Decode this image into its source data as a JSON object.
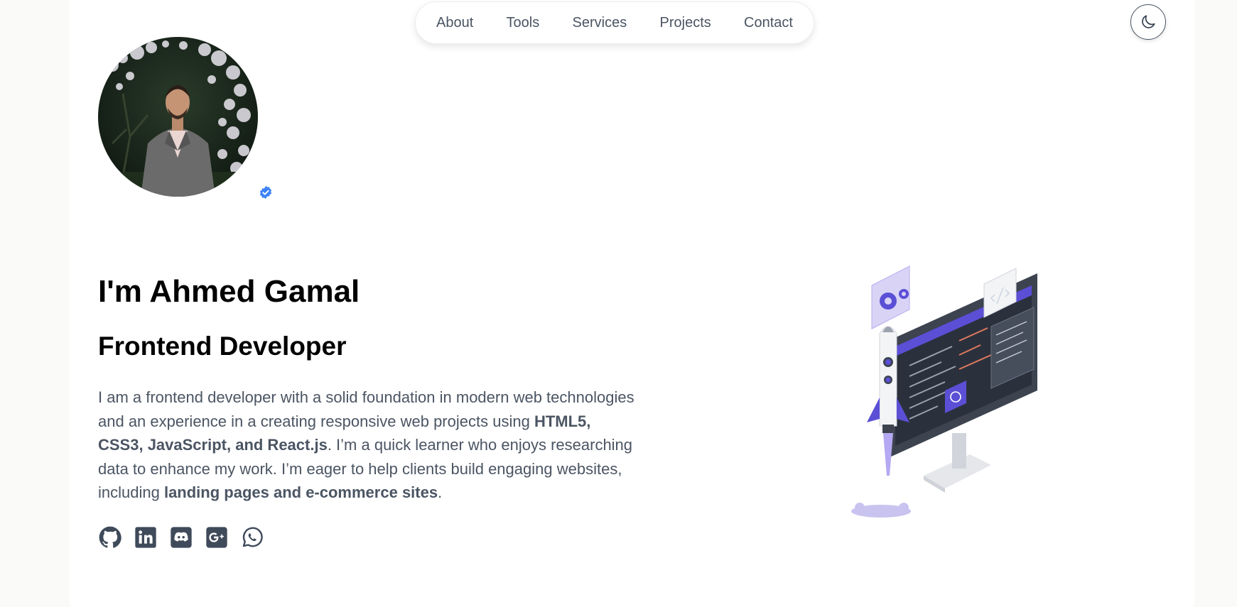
{
  "nav": {
    "items": [
      "About",
      "Tools",
      "Services",
      "Projects",
      "Contact"
    ]
  },
  "theme_toggle": {
    "icon": "moon-icon"
  },
  "profile": {
    "avatar": "profile-photo",
    "verified_icon": "verified-badge-icon"
  },
  "hero": {
    "name": "I'm Ahmed Gamal",
    "role": "Frontend Developer",
    "bio_part1": "I am a frontend developer with a solid foundation in modern web technologies and an experience in a creating responsive web projects using ",
    "bio_bold1": "HTML5, CSS3, JavaScript, and React.js",
    "bio_part2": ". I’m a quick learner who enjoys researching data to enhance my work. I’m eager to help clients build engaging websites, including ",
    "bio_bold2": "landing pages and e-commerce sites",
    "bio_part3": "."
  },
  "socials": [
    {
      "icon": "github-icon"
    },
    {
      "icon": "linkedin-icon"
    },
    {
      "icon": "discord-icon"
    },
    {
      "icon": "google-plus-icon"
    },
    {
      "icon": "whatsapp-icon"
    }
  ],
  "colors": {
    "text_muted": "#4b5563",
    "accent_purple": "#5b4fd6",
    "verified_blue": "#3b82f6"
  }
}
